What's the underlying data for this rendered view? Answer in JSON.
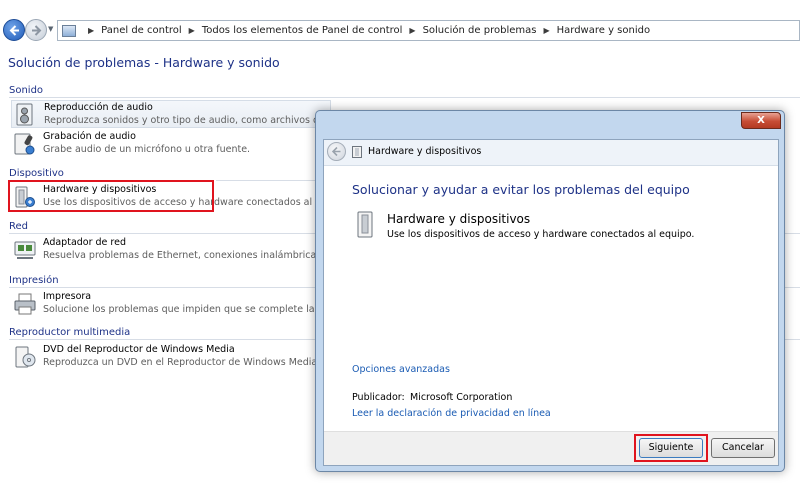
{
  "address": {
    "crumbs": [
      "Panel de control",
      "Todos los elementos de Panel de control",
      "Solución de problemas",
      "Hardware y sonido"
    ]
  },
  "page": {
    "title": "Solución de problemas - Hardware y sonido"
  },
  "sections": [
    {
      "heading": "Sonido",
      "items": [
        {
          "title": "Reproducción de audio",
          "desc": "Reproduzca sonidos y otro tipo de audio, como archivos de mú"
        },
        {
          "title": "Grabación de audio",
          "desc": "Grabe audio de un micrófono u otra fuente."
        }
      ]
    },
    {
      "heading": "Dispositivo",
      "items": [
        {
          "title": "Hardware y dispositivos",
          "desc": "Use los dispositivos de acceso y hardware conectados al equipo."
        }
      ]
    },
    {
      "heading": "Red",
      "items": [
        {
          "title": "Adaptador de red",
          "desc": "Resuelva problemas de Ethernet, conexiones inalámbricas u otr"
        }
      ]
    },
    {
      "heading": "Impresión",
      "items": [
        {
          "title": "Impresora",
          "desc": "Solucione los problemas que impiden que se complete la impres"
        }
      ]
    },
    {
      "heading": "Reproductor multimedia",
      "items": [
        {
          "title": "DVD del Reproductor de Windows Media",
          "desc": "Reproduzca un DVD en el Reproductor de Windows Media."
        }
      ]
    }
  ],
  "dialog": {
    "header_title": "Hardware y dispositivos",
    "close_label": "X",
    "main_title": "Solucionar y ayudar a evitar los problemas del equipo",
    "device_title": "Hardware y dispositivos",
    "device_desc": "Use los dispositivos de acceso y hardware conectados al equipo.",
    "advanced_link": "Opciones avanzadas",
    "publisher_label": "Publicador:",
    "publisher_value": "Microsoft Corporation",
    "privacy_link": "Leer la declaración de privacidad en línea",
    "next_button": "Siguiente",
    "cancel_button": "Cancelar"
  },
  "colors": {
    "highlight": "#e0141e",
    "heading": "#1e3287",
    "link": "#1a5bb3"
  }
}
